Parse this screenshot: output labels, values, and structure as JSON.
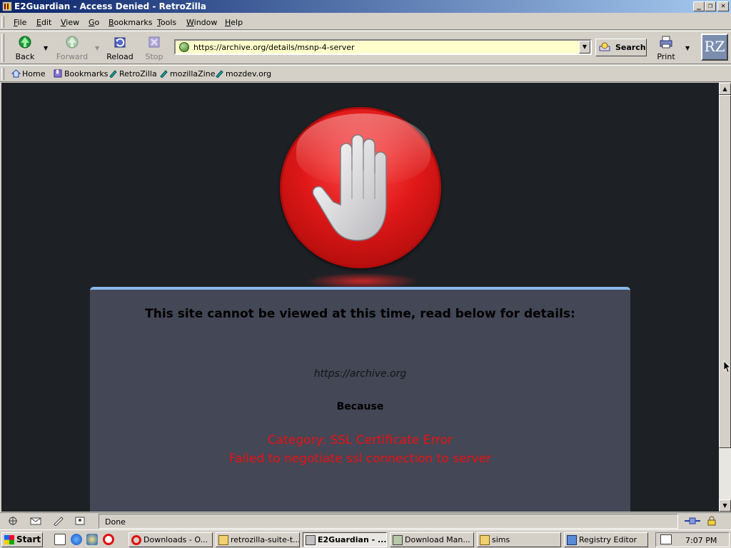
{
  "window": {
    "title": "E2Guardian - Access Denied - RetroZilla",
    "controls": [
      "_",
      "❐",
      "✕"
    ]
  },
  "menubar": {
    "items": [
      {
        "label": "File",
        "key": "F",
        "rest": "ile"
      },
      {
        "label": "Edit",
        "key": "E",
        "rest": "dit"
      },
      {
        "label": "View",
        "key": "V",
        "rest": "iew"
      },
      {
        "label": "Go",
        "key": "G",
        "rest": "o"
      },
      {
        "label": "Bookmarks",
        "key": "B",
        "rest": "ookmarks"
      },
      {
        "label": "Tools",
        "key": "T",
        "rest": "ools"
      },
      {
        "label": "Window",
        "key": "W",
        "rest": "indow"
      },
      {
        "label": "Help",
        "key": "H",
        "rest": "elp"
      }
    ]
  },
  "navbar": {
    "back": "Back",
    "forward": "Forward",
    "reload": "Reload",
    "stop": "Stop",
    "url": "https://archive.org/details/msnp-4-server",
    "search": "Search",
    "print": "Print",
    "logo": "RZ"
  },
  "personal_toolbar": {
    "items": [
      "Home",
      "Bookmarks",
      "RetroZilla",
      "mozillaZine",
      "mozdev.org"
    ]
  },
  "page": {
    "heading": "This site cannot be viewed at this time, read below for details:",
    "blocked_url": "https://archive.org",
    "because": "Because",
    "category": "Category: SSL Certificate Error",
    "reason": "Failed to negotiate ssl connection to server",
    "colors": {
      "background": "#1d2025",
      "panel": "#434756",
      "panel_border": "#8ab8e8",
      "error_text": "#ee1010",
      "stop_red": "#e01818"
    }
  },
  "statusbar": {
    "text": "Done"
  },
  "taskbar": {
    "start": "Start",
    "tasks": [
      {
        "label": "Downloads - O...",
        "icon": "opera-icon"
      },
      {
        "label": "retrozilla-suite-t...",
        "icon": "folder-icon"
      },
      {
        "label": "E2Guardian - ...",
        "icon": "retrozilla-icon",
        "active": true
      },
      {
        "label": "Download Man...",
        "icon": "download-icon"
      },
      {
        "label": "sims",
        "icon": "folder-icon"
      },
      {
        "label": "Registry Editor",
        "icon": "regedit-icon"
      }
    ],
    "clock": "7:07 PM"
  }
}
